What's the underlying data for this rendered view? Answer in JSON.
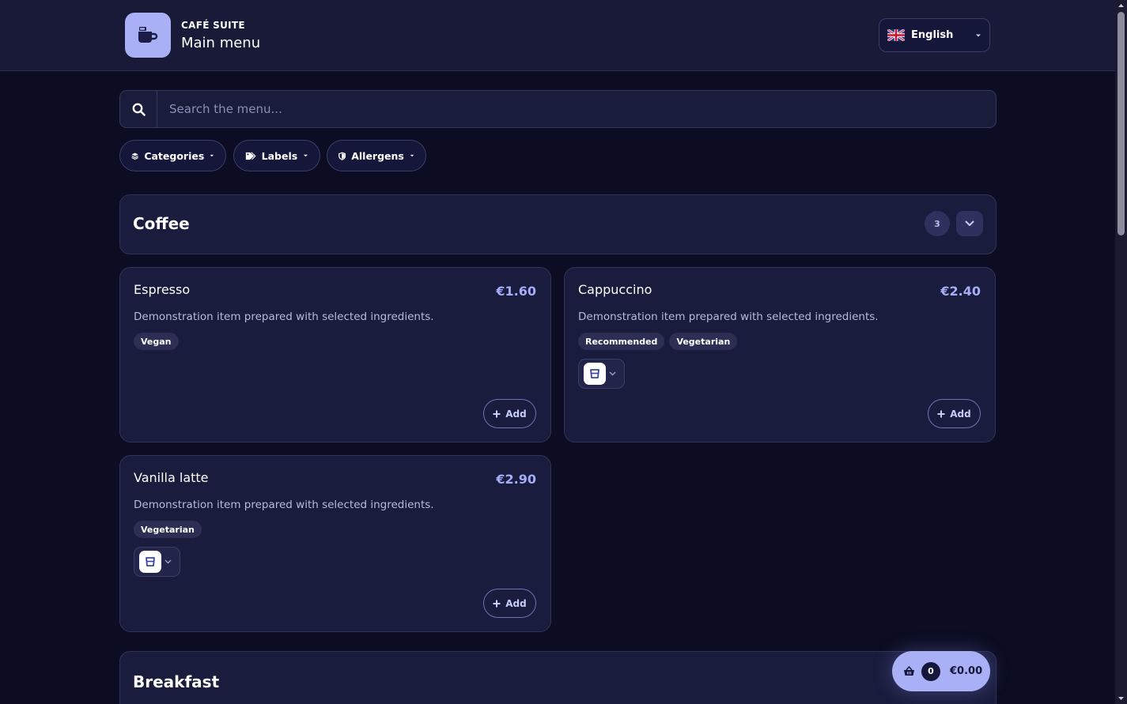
{
  "header": {
    "brand": "CAFÉ SUITE",
    "title": "Main menu",
    "language": "English"
  },
  "search": {
    "placeholder": "Search the menu..."
  },
  "filters": [
    {
      "label": "Categories",
      "icon": "layers-icon"
    },
    {
      "label": "Labels",
      "icon": "tags-icon"
    },
    {
      "label": "Allergens",
      "icon": "shield-icon"
    }
  ],
  "sections": [
    {
      "title": "Coffee",
      "count": "3",
      "items": [
        {
          "name": "Espresso",
          "price": "€1.60",
          "description": "Demonstration item prepared with selected ingredients.",
          "tags": [
            "Vegan"
          ],
          "has_size_select": false,
          "add_label": "Add"
        },
        {
          "name": "Cappuccino",
          "price": "€2.40",
          "description": "Demonstration item prepared with selected ingredients.",
          "tags": [
            "Recommended",
            "Vegetarian"
          ],
          "has_size_select": true,
          "add_label": "Add"
        },
        {
          "name": "Vanilla latte",
          "price": "€2.90",
          "description": "Demonstration item prepared with selected ingredients.",
          "tags": [
            "Vegetarian"
          ],
          "has_size_select": true,
          "add_label": "Add"
        }
      ]
    },
    {
      "title": "Breakfast"
    }
  ],
  "cart": {
    "count": "0",
    "total": "€0.00"
  },
  "colors": {
    "background": "#0c0d22",
    "header": "#181a38",
    "card": "#1a1c3d",
    "accent": "#a9b0f5",
    "price": "#a5adf7"
  }
}
